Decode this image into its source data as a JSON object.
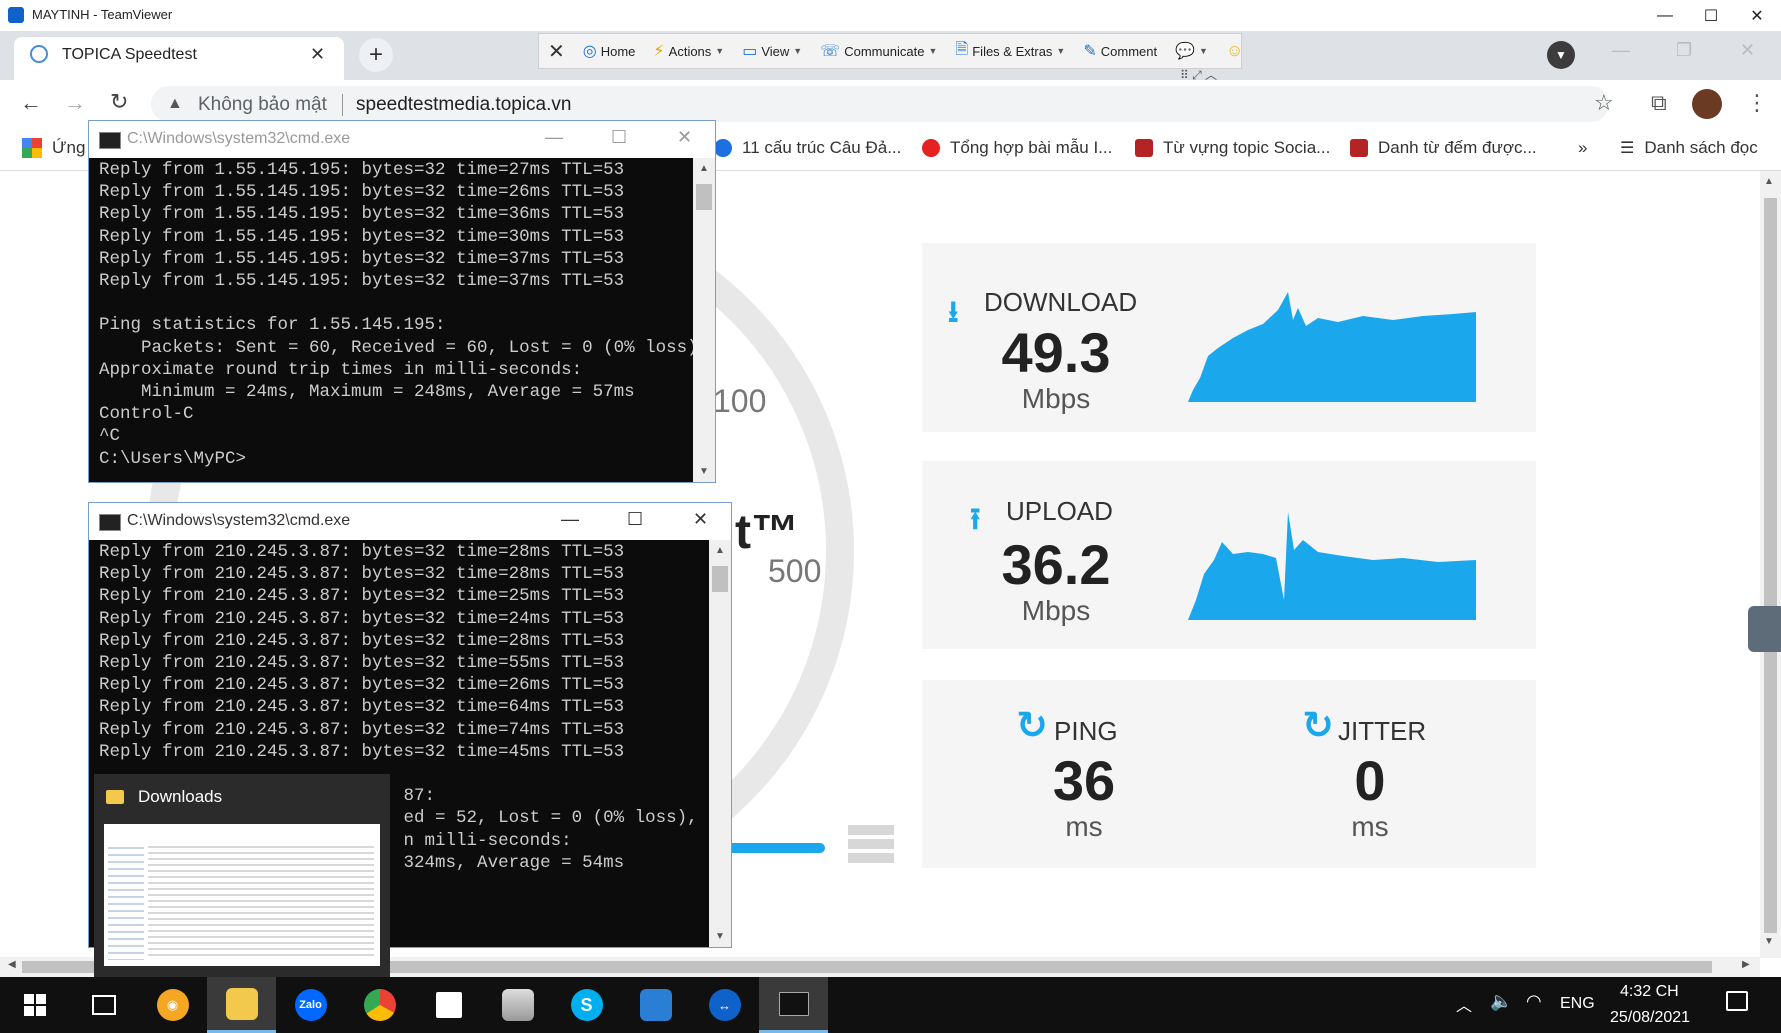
{
  "teamviewer": {
    "window_title": "MAYTINH - TeamViewer",
    "toolbar": {
      "home": "Home",
      "actions": "Actions",
      "view": "View",
      "communicate": "Communicate",
      "files": "Files & Extras",
      "comment": "Comment"
    }
  },
  "browser": {
    "tab_title": "TOPICA Speedtest",
    "security_label": "Không bảo mật",
    "url": "speedtestmedia.topica.vn",
    "bookmarks": [
      {
        "label": "Ứng"
      },
      {
        "label": "11 cấu trúc Câu Đả..."
      },
      {
        "label": "Tổng hợp bài mẫu I..."
      },
      {
        "label": "Từ vựng topic Socia..."
      },
      {
        "label": "Danh từ đếm được..."
      }
    ],
    "bookmarks_more": "»",
    "reading_list": "Danh sách đọc"
  },
  "speedtest": {
    "gauge_100": "100",
    "gauge_500": "500",
    "logo_tail": "t™",
    "download": {
      "label": "DOWNLOAD",
      "value": "49.3",
      "unit": "Mbps"
    },
    "upload": {
      "label": "UPLOAD",
      "value": "36.2",
      "unit": "Mbps"
    },
    "ping": {
      "label": "PING",
      "value": "36",
      "unit": "ms"
    },
    "jitter": {
      "label": "JITTER",
      "value": "0",
      "unit": "ms"
    },
    "colors": {
      "graph": "#1aa7ec",
      "card": "#f5f5f5"
    }
  },
  "cmd1": {
    "title": "C:\\Windows\\system32\\cmd.exe",
    "lines": [
      "Reply from 1.55.145.195: bytes=32 time=27ms TTL=53",
      "Reply from 1.55.145.195: bytes=32 time=26ms TTL=53",
      "Reply from 1.55.145.195: bytes=32 time=36ms TTL=53",
      "Reply from 1.55.145.195: bytes=32 time=30ms TTL=53",
      "Reply from 1.55.145.195: bytes=32 time=37ms TTL=53",
      "Reply from 1.55.145.195: bytes=32 time=37ms TTL=53",
      "",
      "Ping statistics for 1.55.145.195:",
      "    Packets: Sent = 60, Received = 60, Lost = 0 (0% loss),",
      "Approximate round trip times in milli-seconds:",
      "    Minimum = 24ms, Maximum = 248ms, Average = 57ms",
      "Control-C",
      "^C",
      "C:\\Users\\MyPC>"
    ]
  },
  "cmd2": {
    "title": "C:\\Windows\\system32\\cmd.exe",
    "lines": [
      "Reply from 210.245.3.87: bytes=32 time=28ms TTL=53",
      "Reply from 210.245.3.87: bytes=32 time=28ms TTL=53",
      "Reply from 210.245.3.87: bytes=32 time=25ms TTL=53",
      "Reply from 210.245.3.87: bytes=32 time=24ms TTL=53",
      "Reply from 210.245.3.87: bytes=32 time=28ms TTL=53",
      "Reply from 210.245.3.87: bytes=32 time=55ms TTL=53",
      "Reply from 210.245.3.87: bytes=32 time=26ms TTL=53",
      "Reply from 210.245.3.87: bytes=32 time=64ms TTL=53",
      "Reply from 210.245.3.87: bytes=32 time=74ms TTL=53",
      "Reply from 210.245.3.87: bytes=32 time=45ms TTL=53",
      "",
      "                             87:",
      "                             ed = 52, Lost = 0 (0% loss),",
      "                             n milli-seconds:",
      "                             324ms, Average = 54ms"
    ]
  },
  "downloads_preview": {
    "title": "Downloads"
  },
  "taskbar": {
    "apps": [
      "start",
      "task-view",
      "brave",
      "file-explorer",
      "zalo",
      "chrome",
      "notes",
      "drive",
      "skype",
      "outlook",
      "teamviewer",
      "cmd"
    ],
    "zalo_label": "Zalo",
    "language": "ENG",
    "time": "4:32 CH",
    "date": "25/08/2021"
  }
}
